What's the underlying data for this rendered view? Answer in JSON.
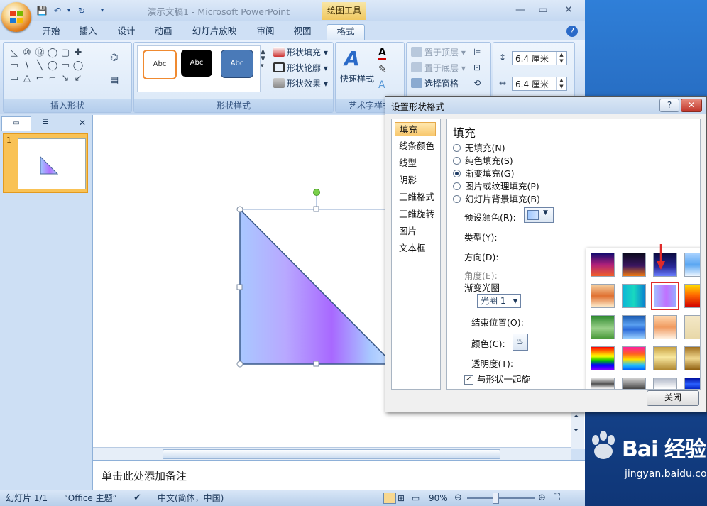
{
  "window": {
    "doc_title": "演示文稿1 - Microsoft PowerPoint",
    "contextual_tab_label": "绘图工具",
    "min_icon": "—",
    "restore_icon": "▭",
    "close_icon": "✕"
  },
  "ribbon_tabs": [
    "开始",
    "插入",
    "设计",
    "动画",
    "幻灯片放映",
    "审阅",
    "视图",
    "格式"
  ],
  "ribbon": {
    "insert_shapes": {
      "label": "插入形状",
      "shapes": [
        "◺",
        "⑩",
        "⑫",
        "◯",
        "▢",
        "✚",
        "▭",
        "\\",
        "╲",
        "◯",
        "▭",
        "◯",
        "▭",
        "△",
        "⌐",
        "⌐",
        "↘",
        "↙"
      ]
    },
    "shape_styles": {
      "label": "形状样式",
      "thumbs": [
        "Abc",
        "Abc",
        "Abc"
      ],
      "fill_label": "形状填充",
      "outline_label": "形状轮廓",
      "effects_label": "形状效果"
    },
    "wordart": {
      "label": "艺术字样式",
      "quick_styles_label": "快速样式"
    },
    "arrange": {
      "bring_front": "置于顶层",
      "send_back": "置于底层",
      "selection_pane": "选择窗格"
    },
    "size": {
      "height_value": "6.4 厘米",
      "width_value": "6.4 厘米"
    }
  },
  "slide_pane": {
    "slide_number": "1"
  },
  "notes": {
    "placeholder": "单击此处添加备注"
  },
  "status": {
    "slide_info": "幻灯片 1/1",
    "theme": "“Office 主题”",
    "language": "中文(简体，中国)",
    "zoom": "90%"
  },
  "dialog": {
    "title": "设置形状格式",
    "help": "?",
    "close_x": "✕",
    "sidebar": [
      "填充",
      "线条颜色",
      "线型",
      "阴影",
      "三维格式",
      "三维旋转",
      "图片",
      "文本框"
    ],
    "heading": "填充",
    "fill_options": [
      "无填充(N)",
      "纯色填充(S)",
      "渐变填充(G)",
      "图片或纹理填充(P)",
      "幻灯片背景填充(B)"
    ],
    "selected_option": "渐变填充(G)",
    "preset_label": "预设颜色(R):",
    "type_label": "类型(Y):",
    "direction_label": "方向(D):",
    "angle_label": "角度(E):",
    "stops_label": "渐变光圈",
    "stop_value": "光圈 1",
    "end_pos_label": "结束位置(O):",
    "color_label": "颜色(C):",
    "transparency_label": "透明度(T):",
    "rotate_label": "与形状一起旋",
    "close_button": "关闭",
    "presets": [
      "linear-gradient(#120a6e,#b0207a 50%,#f0602a)",
      "linear-gradient(#0c0a1e,#3b1660 55%,#f07a10)",
      "linear-gradient(#0a0a40,#2a2a9a 60%,#6a80ff)",
      "linear-gradient(#a9d2ff,#5aa6f2 50%,#eef6ff)",
      "linear-gradient(#cfd9e6,#4a6a90 45%,#a82020 60%,#fff)",
      "linear-gradient(#f5d0a0,#e07030 50%,#fff0d0)",
      "linear-gradient(90deg,#0bb4d8,#18d8c0 50%,#0a7fd0)",
      "linear-gradient(90deg,#a0c8ff,#c070ff 55%,#90b8ff)",
      "linear-gradient(#ffe000,#ff6a00 45%,#d00000)",
      "linear-gradient(#8a8fe8,#d8dcff 50%,#9a9ef0)",
      "linear-gradient(#2f8a2f,#9ad08a 55%,#4a9a3a)",
      "linear-gradient(#1a5ab0,#5aa0f0 40%,#2a6ad8 60%,#9ad0ff)",
      "linear-gradient(#ffd8b0,#f09a60 50%,#fff0e0)",
      "linear-gradient(#f4e8c8,#e8d8a8)",
      "linear-gradient(#c07a3a,#a05020 50%,#e0b080)",
      "linear-gradient(#ff0000,#ff8000 20%,#ffff00 40%,#00c000 60%,#0000ff 80%,#8000ff)",
      "linear-gradient(#ff20a0,#ff6020 30%,#ffe000 55%,#20c0ff 80%,#0060ff)",
      "linear-gradient(#c8a040,#f8e8a0 45%,#b08830)",
      "linear-gradient(#a07020,#f0d890 50%,#906010)",
      "linear-gradient(#c07000,#ffd040 20%,#b06000 40%,#ffd040 60%,#b06000 80%,#ffd040)",
      "linear-gradient(#e0e0e0,#505050 25%,#f0f0f0 45%,#606060 70%,#e8e8e8)",
      "linear-gradient(#d0d0d0,#303030 55%,#e0e0e0)",
      "linear-gradient(#b0b8c8,#ffffff 45%,#9098a8)",
      "linear-gradient(#0010a0,#2a60ff 25%,#0020c0 50%,#3a70ff 75%,#0010a0)"
    ],
    "highlighted_preset_index": 7
  },
  "watermark": {
    "brand": "Bai 经验",
    "url": "jingyan.baidu.com"
  },
  "colors": {
    "accent_orange": "#f8c86e",
    "highlight_red": "#e02a2a",
    "triangle_fill": "lavender-to-purple gradient"
  }
}
